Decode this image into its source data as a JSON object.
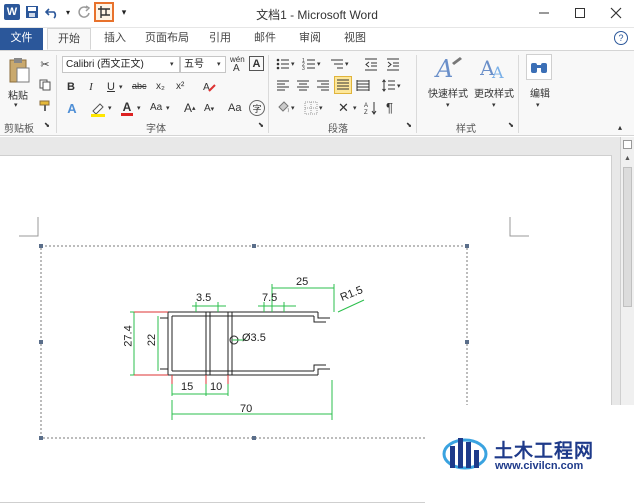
{
  "window": {
    "title": "文档1 - Microsoft Word"
  },
  "qat": {
    "undo_arrow": "▾",
    "customize": "▾"
  },
  "tabs": [
    "文件",
    "开始",
    "插入",
    "页面布局",
    "引用",
    "邮件",
    "审阅",
    "视图"
  ],
  "clipboard": {
    "paste": "粘贴",
    "group": "剪贴板"
  },
  "font": {
    "name": "Calibri (西文正文)",
    "size": "五号",
    "group": "字体",
    "wen": "wén",
    "wen_char": "A"
  },
  "paragraph": {
    "group": "段落"
  },
  "styles": {
    "quick": "快速样式",
    "change": "更改样式",
    "group": "样式"
  },
  "editing": {
    "label": "编辑"
  },
  "drawing": {
    "dims": [
      "3.5",
      "7.5",
      "25",
      "R1.5",
      "27.4",
      "22",
      "Ø3.5",
      "15",
      "10",
      "70"
    ]
  },
  "watermark": {
    "title": "土木工程网",
    "url": "www.civilcn.com"
  }
}
